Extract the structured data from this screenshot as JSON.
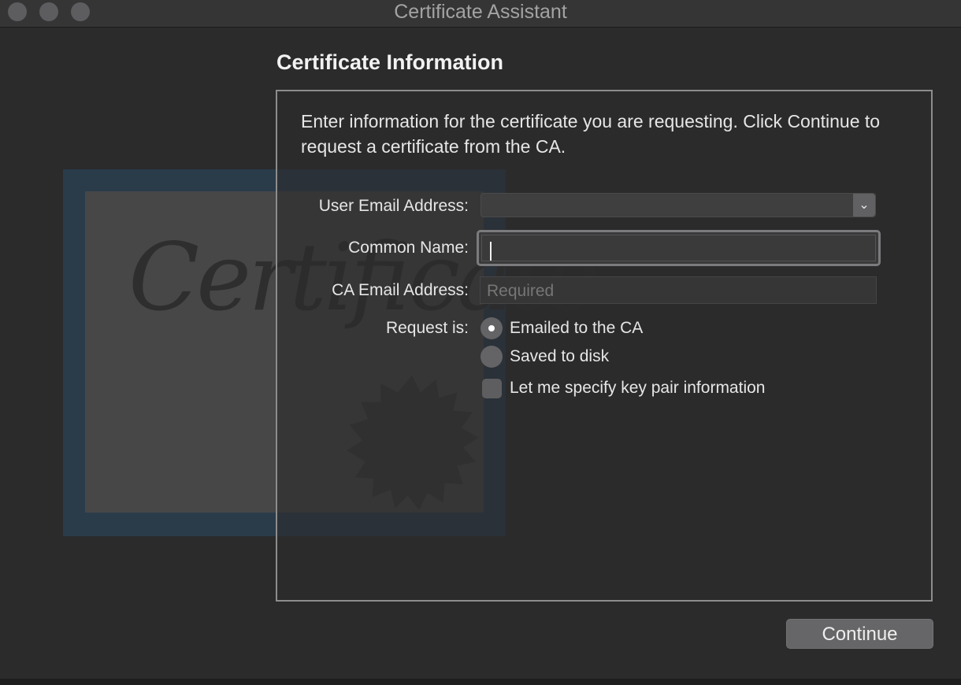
{
  "window": {
    "title": "Certificate Assistant"
  },
  "page": {
    "heading": "Certificate Information",
    "instructions": "Enter information for the certificate you are requesting. Click Continue to request a certificate from the CA."
  },
  "form": {
    "user_email_label": "User Email Address:",
    "user_email_value": "",
    "common_name_label": "Common Name:",
    "common_name_value": "",
    "ca_email_label": "CA Email Address:",
    "ca_email_placeholder": "Required",
    "request_label": "Request is:",
    "options": {
      "emailed": "Emailed to the CA",
      "saved": "Saved to disk",
      "key_pair": "Let me specify key pair information"
    },
    "selected_option": "Emailed to the CA",
    "key_pair_checked": false
  },
  "buttons": {
    "continue": "Continue"
  },
  "illustration": {
    "script_text": "Certificate"
  },
  "icons": {
    "popup_arrow": "chevron-down-icon",
    "seal": "seal-icon"
  },
  "colors": {
    "background": "#2b2b2c",
    "titlebar": "#353536",
    "text": "#e6e6e6",
    "button": "#666668"
  }
}
